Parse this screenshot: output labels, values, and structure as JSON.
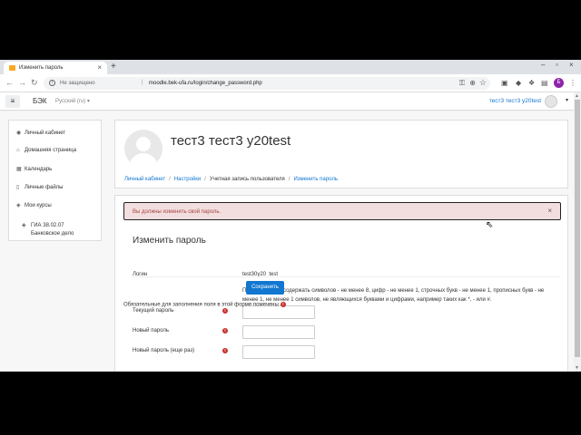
{
  "browser": {
    "tab_title": "Изменить пароль",
    "new_tab": "+",
    "security_label": "Не защищено",
    "url_separator": "|",
    "url": "moodle.bek-ufa.ru/login/change_password.php",
    "profile_initial": "Б"
  },
  "navbar": {
    "brand": "БЭК",
    "language": "Русский (ru) ▾",
    "username": "тест3 тест3 у20test"
  },
  "sidebar": {
    "items": [
      {
        "icon": "dashboard-icon",
        "label": "Личный кабинет"
      },
      {
        "icon": "home-icon",
        "label": "Домашняя страница"
      },
      {
        "icon": "calendar-icon",
        "label": "Календарь"
      },
      {
        "icon": "file-icon",
        "label": "Личные файлы"
      },
      {
        "icon": "graduation-cap-icon",
        "label": "Мои курсы"
      }
    ],
    "course": {
      "line1": "ГИА 38.02.07",
      "line2": "Банковское дело"
    }
  },
  "header": {
    "fullname": "тест3 тест3 у20test",
    "breadcrumb": [
      "Личный кабинет",
      "Настройки",
      "Учетная запись пользователя",
      "Изменить пароль"
    ]
  },
  "alert": {
    "message": "Вы должны изменить свой пароль.",
    "close": "×"
  },
  "form": {
    "title": "Изменить пароль",
    "login_label": "Логин",
    "login_value": "test30y20_test",
    "policy": "Пароль должен содержать символов - не менее 8, цифр - не менее 1, строчных букв - не менее 1, прописных букв - не менее 1, не менее 1 символов, не являющихся буквами и цифрами, например таких как *, - или #.",
    "current_label": "Текущий пароль",
    "new_label": "Новый пароль",
    "repeat_label": "Новый пароль (еще раз)",
    "required_mark": "!",
    "save_label": "Сохранить",
    "required_note": "Обязательные для заполнения поля в этой форме помечены"
  },
  "colors": {
    "link": "#1177d1",
    "alert_bg": "#f2dede",
    "alert_text": "#a94442",
    "required": "#c9302c",
    "button": "#1177d1"
  }
}
